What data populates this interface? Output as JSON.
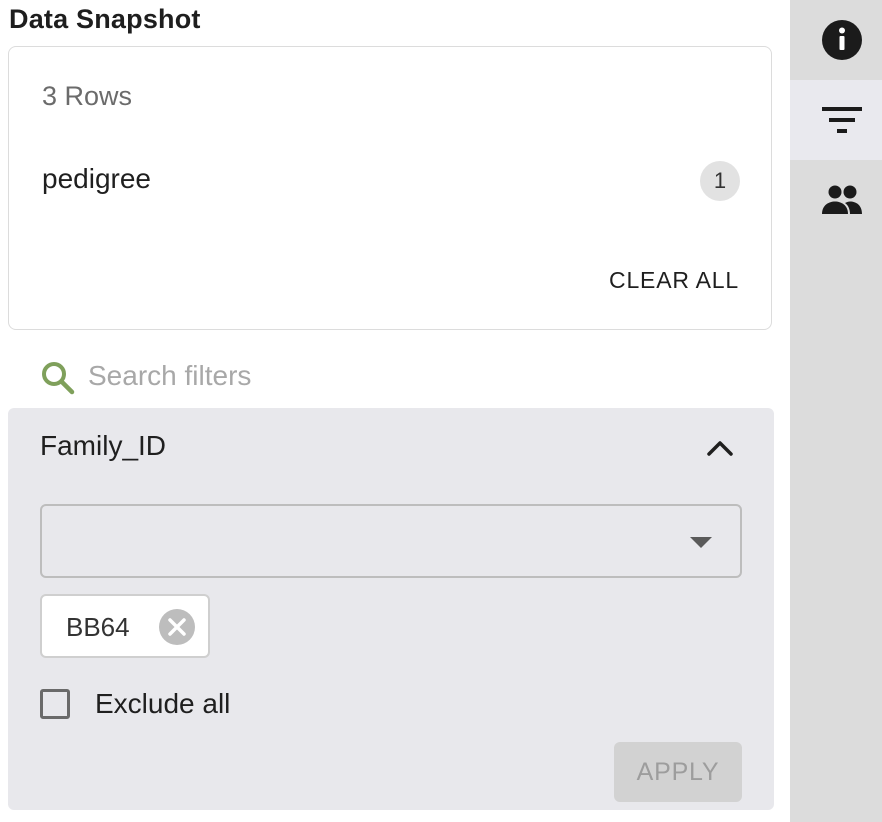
{
  "snapshot": {
    "title": "Data Snapshot",
    "rows_label": "3 Rows",
    "active_filters": [
      {
        "label": "pedigree",
        "count": "1"
      }
    ],
    "clear_all_label": "CLEAR ALL"
  },
  "search": {
    "placeholder": "Search filters",
    "value": ""
  },
  "filter": {
    "name": "Family_ID",
    "dropdown_value": "",
    "selected_tags": [
      "BB64"
    ],
    "exclude_label": "Exclude all",
    "exclude_checked": false,
    "apply_label": "APPLY",
    "apply_enabled": false
  },
  "side_rail": {
    "tabs": [
      {
        "icon": "info-icon",
        "active": false
      },
      {
        "icon": "filter-icon",
        "active": true
      },
      {
        "icon": "people-icon",
        "active": false
      }
    ]
  },
  "colors": {
    "search_icon": "#7fa05b",
    "panel_bg": "#e8e8ec",
    "rail_bg": "#dcdcdc",
    "apply_disabled_bg": "#d2d2d2"
  }
}
